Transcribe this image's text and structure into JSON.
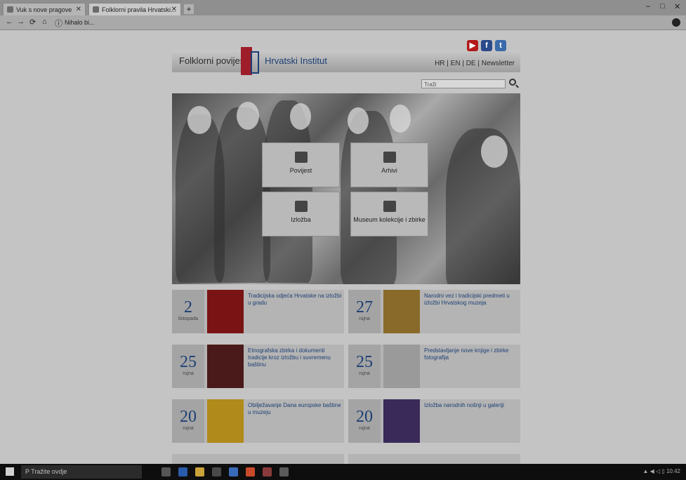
{
  "browser": {
    "tabs": [
      {
        "title": "Vuk s nove pragove"
      },
      {
        "title": "Folklorni pravila Hrvatski..."
      }
    ],
    "url": "Nihalo bi...",
    "window_controls": [
      "–",
      "□",
      "✕"
    ]
  },
  "site": {
    "logo_left": "Folklorni povijest",
    "logo_right": "Hrvatski Institut",
    "languages": "HR | EN | DE | Newsletter",
    "search_placeholder": "Traži",
    "hero_tiles": [
      {
        "label": "Povijest",
        "icon": "building-icon"
      },
      {
        "label": "Arhivi",
        "icon": "archive-icon"
      },
      {
        "label": "Izložba",
        "icon": "exhibit-icon"
      },
      {
        "label": "Museum kolekcije i zbirke",
        "icon": "collection-icon"
      }
    ],
    "news": [
      {
        "day": "2",
        "month": "listopada",
        "text": "Tradicijska odjeća Hrvatske na izložbi u gradu",
        "thumb": "#7a1414"
      },
      {
        "day": "27",
        "month": "rujna",
        "text": "Narodni vez i tradicijski predmeti u izložbi Hrvatskog muzeja",
        "thumb": "#8a6a2a"
      },
      {
        "day": "25",
        "month": "rujna",
        "text": "Etnografska zbirka i dokumenti tradicije kroz izložbu i suvremenu baštinu",
        "thumb": "#4a1a1a"
      },
      {
        "day": "25",
        "month": "rujna",
        "text": "Predstavljanje nove knjige i zbirke fotografija",
        "thumb": "#9a9a9a"
      },
      {
        "day": "20",
        "month": "rujna",
        "text": "Obilježavanje Dana europske baštine u muzeju",
        "thumb": "#b08a1a"
      },
      {
        "day": "20",
        "month": "rujna",
        "text": "Izložba narodnih nošnji u galeriji",
        "thumb": "#3a2a5a"
      }
    ]
  },
  "taskbar": {
    "search_text": "P Tražite ovdje",
    "tray_text": "▲ ◀ ◁ ▯ 10:42"
  }
}
